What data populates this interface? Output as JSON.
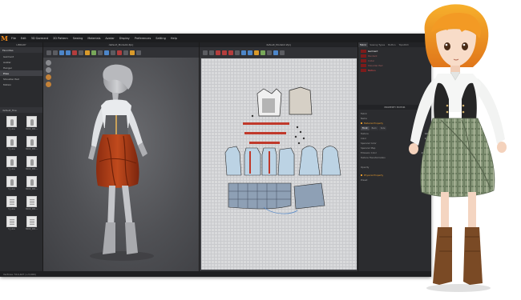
{
  "menubar": {
    "logo": "M",
    "items": [
      "File",
      "Edit",
      "3D Garment",
      "2D Pattern",
      "Sewing",
      "Materials",
      "Avatar",
      "Display",
      "Preferences",
      "Setting",
      "Help"
    ],
    "user_label": "Hello, marvelous",
    "simulation_label": "SIMULATION",
    "workspace_label": "OBJECT BROWSER"
  },
  "library": {
    "title": "LIBRARY",
    "header": "Favorites",
    "items": [
      "Garment",
      "Avatar",
      "Hanger",
      "Pose",
      "Shoulder Pad",
      "Motion"
    ],
    "active_index": 3,
    "path_label": "default_fine",
    "thumbnails": [
      {
        "label": "5_Line",
        "kind": "garment"
      },
      {
        "label": "3000_001...",
        "kind": "garment"
      },
      {
        "label": "5_Line",
        "kind": "garment"
      },
      {
        "label": "3000_001...",
        "kind": "garment"
      },
      {
        "label": "5_Line",
        "kind": "garment"
      },
      {
        "label": "3000_001...",
        "kind": "garment"
      },
      {
        "label": "5_Line",
        "kind": "garment"
      },
      {
        "label": "3000_001...",
        "kind": "garment"
      },
      {
        "label": "5_Line",
        "kind": "doc"
      },
      {
        "label": "3000_001...",
        "kind": "doc"
      },
      {
        "label": "5_Line",
        "kind": "doc"
      },
      {
        "label": "3000_001...",
        "kind": "doc"
      }
    ]
  },
  "view3d": {
    "tab_label": "default_Modeli2.Zprj"
  },
  "view2d": {
    "tab_label": "default_Modeli2.Zprj"
  },
  "object_browser": {
    "tabs": [
      "Fabric",
      "Sewing Types",
      "Button",
      "Topstitch"
    ],
    "active_tab": 0,
    "list": [
      {
        "name": "Garment",
        "style": "hl"
      },
      {
        "name": "Pendant",
        "style": "fad"
      },
      {
        "name": "Collar",
        "style": "fad"
      },
      {
        "name": "Shoulder Pad",
        "style": "fad"
      },
      {
        "name": "Motion",
        "style": "sel"
      }
    ]
  },
  "property_editor": {
    "title": "PROPERTY EDITOR",
    "rows_top": [
      {
        "label": "Fabric",
        "value": ""
      },
      {
        "label": "Name",
        "value": ""
      }
    ],
    "section_material": "Material Property",
    "subtabs": [
      "Front",
      "Back",
      "Side"
    ],
    "active_subtab": 0,
    "rows_material": [
      {
        "label": "Texture",
        "value": "100"
      },
      {
        "label": "Color",
        "value": "100"
      },
      {
        "label": "Specular Color",
        "value": "100"
      },
      {
        "label": "Specular Map",
        "value": "100"
      },
      {
        "label": "Emission Color",
        "value": "100/00"
      },
      {
        "label": "Texture Transformation",
        "value": ""
      }
    ],
    "opacity_label": "Opacity",
    "opacity_value": "100",
    "section_physical": "Physical Property",
    "preset_label": "Preset"
  },
  "statusbar": {
    "text": "Vertices: 514,447 (+3,000)"
  },
  "colors": {
    "app_bg": "#2e2f32",
    "accent_orange": "#e59a2c",
    "skirt_red": "#b4441a",
    "selection_red": "#ff5151",
    "pattern_blue": "#a9bccf"
  }
}
